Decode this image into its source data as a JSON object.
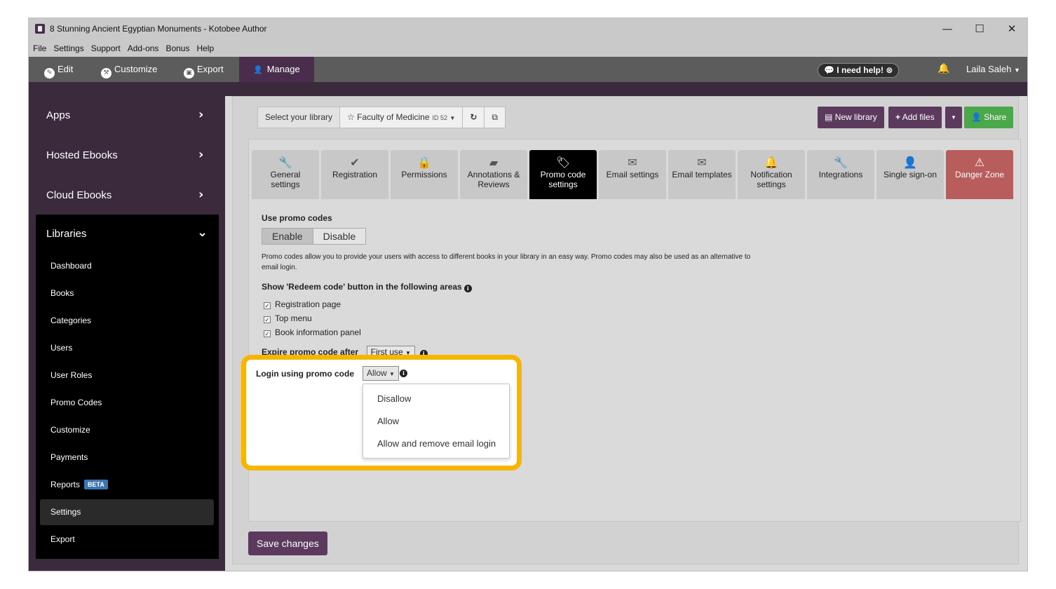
{
  "window": {
    "title": "8 Stunning Ancient Egyptian Monuments - Kotobee Author",
    "minimize": "—",
    "maximize": "☐",
    "close": "✕"
  },
  "menu": [
    "File",
    "Settings",
    "Support",
    "Add-ons",
    "Bonus",
    "Help"
  ],
  "top_tabs": {
    "edit": "Edit",
    "customize": "Customize",
    "export": "Export",
    "manage": "Manage",
    "help": "I need help!",
    "user": "Laila Saleh"
  },
  "sidebar": {
    "main": [
      "Apps",
      "Hosted Ebooks",
      "Cloud Ebooks"
    ],
    "libraries": "Libraries",
    "items": [
      "Dashboard",
      "Books",
      "Categories",
      "Users",
      "User Roles",
      "Promo Codes",
      "Customize",
      "Payments",
      "Reports",
      "Settings",
      "Export"
    ],
    "beta_badge": "BETA",
    "active_item": "Settings"
  },
  "toolbar": {
    "select_label": "Select your library",
    "library_name": "Faculty of Medicine",
    "library_id": "ID 52",
    "new_library": "New library",
    "add_files": "Add files",
    "share": "Share"
  },
  "settings_tabs": [
    {
      "label1": "General",
      "label2": "settings",
      "icon": "wrench-icon"
    },
    {
      "label1": "Registration",
      "label2": "",
      "icon": "check-icon"
    },
    {
      "label1": "Permissions",
      "label2": "",
      "icon": "lock-icon"
    },
    {
      "label1": "Annotations &",
      "label2": "Reviews",
      "icon": "note-icon"
    },
    {
      "label1": "Promo code",
      "label2": "settings",
      "icon": "tag-icon"
    },
    {
      "label1": "Email settings",
      "label2": "",
      "icon": "envelope-icon"
    },
    {
      "label1": "Email templates",
      "label2": "",
      "icon": "envelope-icon"
    },
    {
      "label1": "Notification",
      "label2": "settings",
      "icon": "bell-icon"
    },
    {
      "label1": "Integrations",
      "label2": "",
      "icon": "wrench-icon"
    },
    {
      "label1": "Single sign-on",
      "label2": "",
      "icon": "user-icon"
    },
    {
      "label1": "Danger Zone",
      "label2": "",
      "icon": "warning-icon"
    }
  ],
  "promo": {
    "use_title": "Use promo codes",
    "enable": "Enable",
    "disable": "Disable",
    "description": "Promo codes allow you to provide your users with access to different books in your library in an easy way. Promo codes may also be used as an alternative to email login.",
    "redeem_title": "Show 'Redeem code' button in the following areas",
    "areas": [
      "Registration page",
      "Top menu",
      "Book information panel"
    ],
    "expire_label": "Expire promo code after",
    "expire_value": "First use",
    "login_label": "Login using promo code",
    "login_value": "Allow",
    "login_options": [
      "Disallow",
      "Allow",
      "Allow and remove email login"
    ]
  },
  "save_button": "Save changes",
  "colors": {
    "brand_purple": "#4a2c4c",
    "highlight": "#f7b500",
    "share_green": "#4aa84a",
    "danger": "#b85c5c"
  }
}
